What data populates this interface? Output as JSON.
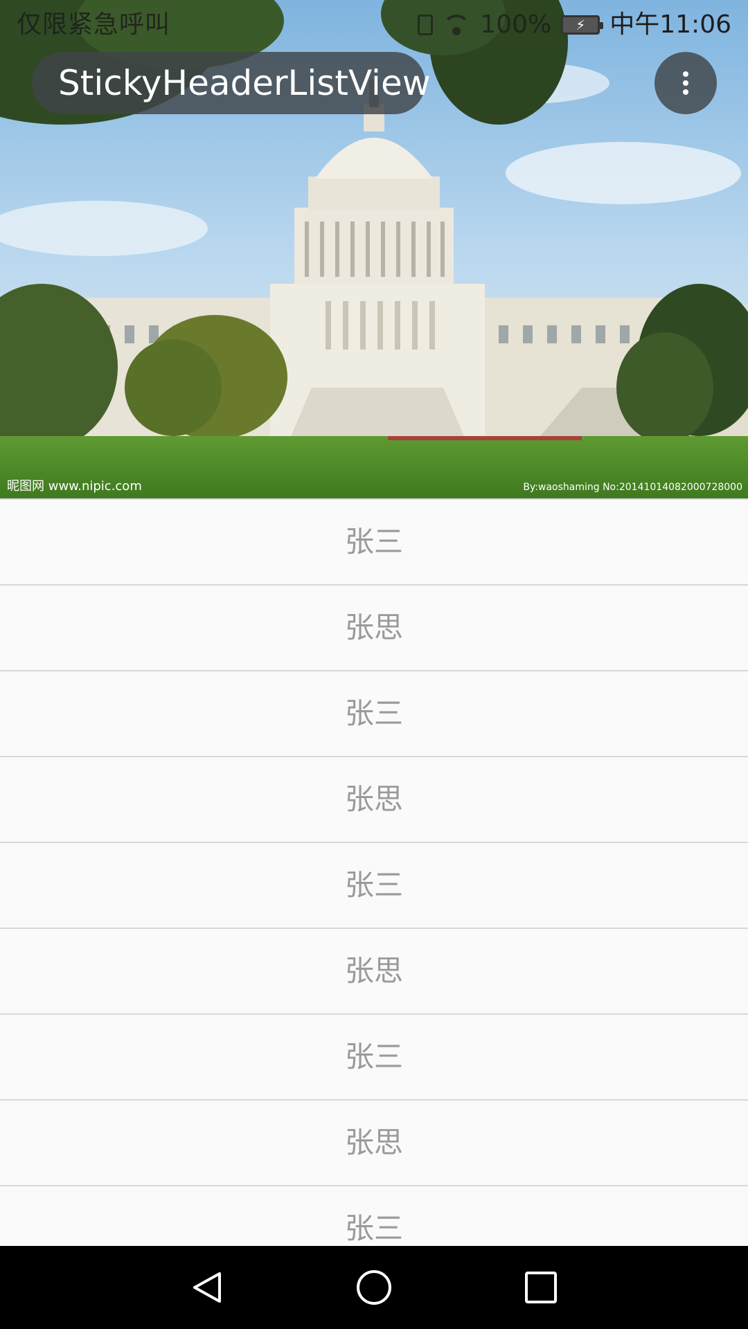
{
  "status_bar": {
    "left_text": "仅限紧急呼叫",
    "battery_percent": "100%",
    "time": "中午11:06"
  },
  "toolbar": {
    "title": "StickyHeaderListView",
    "menu_icon": "more-vert-icon"
  },
  "header_image": {
    "watermark_left": "昵图网 www.nipic.com",
    "watermark_right": "By:waoshaming No:20141014082000728000"
  },
  "list": {
    "items": [
      {
        "label": "张三"
      },
      {
        "label": "张思"
      },
      {
        "label": "张三"
      },
      {
        "label": "张思"
      },
      {
        "label": "张三"
      },
      {
        "label": "张思"
      },
      {
        "label": "张三"
      },
      {
        "label": "张思"
      },
      {
        "label": "张三"
      }
    ]
  },
  "nav_bar": {
    "back_icon": "back-triangle-icon",
    "home_icon": "home-circle-icon",
    "recent_icon": "recent-square-icon"
  }
}
